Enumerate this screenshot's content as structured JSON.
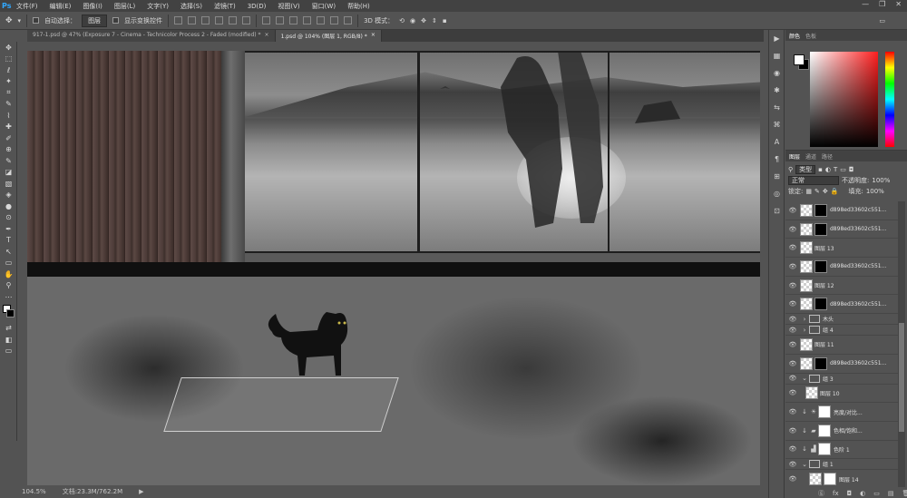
{
  "app": {
    "logo": "Ps"
  },
  "menu": [
    "文件(F)",
    "编辑(E)",
    "图像(I)",
    "图层(L)",
    "文字(Y)",
    "选择(S)",
    "滤镜(T)",
    "3D(D)",
    "视图(V)",
    "窗口(W)",
    "帮助(H)"
  ],
  "window_controls": [
    "—",
    "❐",
    "✕"
  ],
  "options": {
    "auto_select_label": "自动选择：",
    "auto_select_value": "图层",
    "show_transform_label": "显示变换控件",
    "mode_3d_label": "3D 模式："
  },
  "tabs": [
    {
      "label": "917-1.psd @ 47% (Exposure 7 - Cinema - Technicolor Process 2 - Faded (modified) *",
      "close": "×"
    },
    {
      "label": "1.psd @ 104% (图层 1, RGB/8) *",
      "close": "×"
    }
  ],
  "status": {
    "zoom": "104.5%",
    "doc": "文档:23.3M/762.2M",
    "arrow": "▶"
  },
  "color_panel": {
    "tabs": [
      "颜色",
      "色板"
    ],
    "foreground": "#ffffff",
    "background": "#000000"
  },
  "layers_panel": {
    "tabs": [
      "图层",
      "通道",
      "路径"
    ],
    "filter_kind": "类型",
    "blend_mode": "正常",
    "opacity_label": "不透明度:",
    "opacity_value": "100%",
    "lock_label": "锁定:",
    "fill_label": "填充:",
    "fill_value": "100%",
    "layers": [
      {
        "name": "d898ed33602c551...",
        "type": "masked"
      },
      {
        "name": "d898ed33602c551...",
        "type": "masked"
      },
      {
        "name": "图层 13",
        "type": "layer"
      },
      {
        "name": "d898ed33602c551...",
        "type": "masked"
      },
      {
        "name": "图层 12",
        "type": "layer"
      },
      {
        "name": "d898ed33602c551...",
        "type": "masked"
      },
      {
        "name": "木头",
        "type": "group"
      },
      {
        "name": "组 4",
        "type": "group"
      },
      {
        "name": "图层 11",
        "type": "layer"
      },
      {
        "name": "d898ed33602c551...",
        "type": "masked"
      },
      {
        "name": "组 3",
        "type": "group"
      },
      {
        "name": "图层 10",
        "type": "layer"
      },
      {
        "name": "亮度/对比...",
        "type": "adjust"
      },
      {
        "name": "色相/饱和...",
        "type": "adjust"
      },
      {
        "name": "色阶 1",
        "type": "adjust"
      },
      {
        "name": "组 1",
        "type": "group"
      },
      {
        "name": "图层 14",
        "type": "adjust"
      }
    ],
    "bottom_icons": [
      "ⓖ",
      "fx",
      "◘",
      "◐",
      "▭",
      "▤",
      "🗑"
    ]
  },
  "dock_icons": [
    "▶",
    "▦",
    "◉",
    "✱",
    "⇆",
    "⌘",
    "A",
    "¶",
    "⊞",
    "◎",
    "⊡"
  ],
  "tools": [
    "✥",
    "⬚",
    "ℓ",
    "✦",
    "⌗",
    "✎",
    "⌇",
    "✚",
    "✐",
    "⊕",
    "✎",
    "◪",
    "▧",
    "◈",
    "●",
    "⊙",
    "✒",
    "T",
    "↖",
    "▭",
    "✋",
    "⚲",
    "⋯",
    "▣",
    "⇄",
    "◧",
    "▭"
  ]
}
